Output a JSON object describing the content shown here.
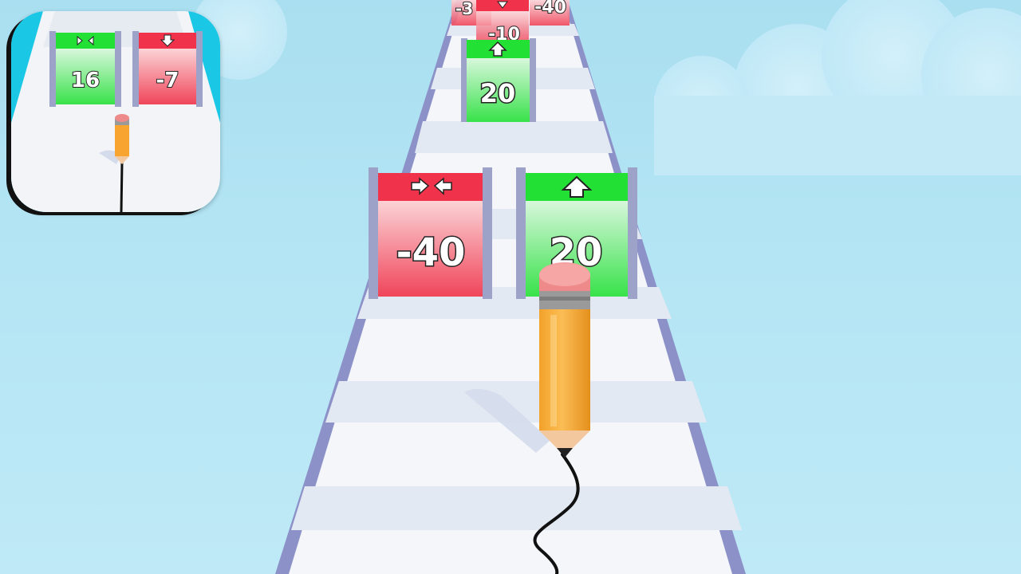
{
  "app_icon": {
    "gates": [
      {
        "value": "16",
        "color": "green",
        "icon": "shrink-arrows-icon"
      },
      {
        "value": "-7",
        "color": "red",
        "icon": "down-arrow-icon"
      }
    ]
  },
  "gates": {
    "far": [
      {
        "value": "-3",
        "color": "red"
      },
      {
        "value": "-40",
        "color": "red",
        "icon": "down-arrow-icon"
      },
      {
        "value": "-10",
        "color": "red"
      },
      {
        "value": "20",
        "color": "green",
        "icon": "up-arrow-icon"
      }
    ],
    "near": [
      {
        "value": "-40",
        "color": "red",
        "icon": "shrink-arrows-icon"
      },
      {
        "value": "20",
        "color": "green",
        "icon": "up-arrow-icon"
      }
    ]
  },
  "colors": {
    "sky": "#b4e5f4",
    "track": "#f4f6fa",
    "rail": "#8c92c8",
    "gate_red": "#f0324b",
    "gate_green": "#22e034",
    "pencil_body": "#f7a530",
    "eraser": "#ee8a8a"
  }
}
